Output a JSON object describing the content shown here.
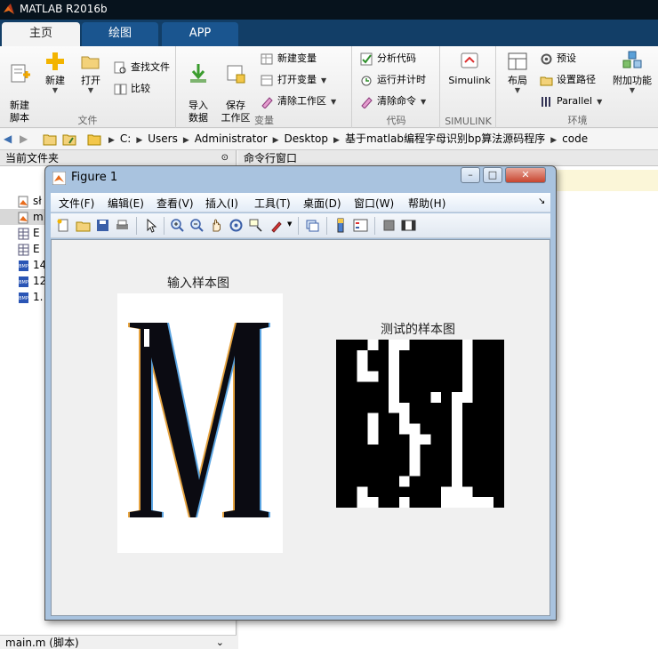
{
  "window": {
    "title": "MATLAB R2016b"
  },
  "tabs": [
    {
      "label": "主页",
      "active": true
    },
    {
      "label": "绘图",
      "active": false
    },
    {
      "label": "APP",
      "active": false
    }
  ],
  "ribbon": {
    "file": {
      "label": "文件",
      "new_script": "新建\n脚本",
      "new": "新建",
      "open": "打开",
      "find_files": "查找文件",
      "compare": "比较"
    },
    "variable": {
      "label": "变量",
      "import_data": "导入\n数据",
      "save_workspace": "保存\n工作区",
      "new_variable": "新建变量",
      "open_variable": "打开变量",
      "clear_workspace": "清除工作区"
    },
    "code": {
      "label": "代码",
      "analyze_code": "分析代码",
      "run_and_time": "运行并计时",
      "clear_commands": "清除命令"
    },
    "simulink": {
      "label": "SIMULINK",
      "button": "Simulink"
    },
    "environment": {
      "label": "环境",
      "layout": "布局",
      "preferences": "预设",
      "set_path": "设置路径",
      "parallel": "Parallel",
      "addons": "附加功能"
    }
  },
  "address": {
    "crumbs": [
      "C:",
      "Users",
      "Administrator",
      "Desktop",
      "基于matlab编程字母识别bp算法源码程序",
      "code"
    ]
  },
  "left_panel": {
    "title": "当前文件夹",
    "files": [
      "sł",
      "m",
      "E",
      "E",
      "14",
      "12",
      "1."
    ],
    "status": "main.m  (脚本)"
  },
  "right_panel": {
    "title": "命令行窗口"
  },
  "figure": {
    "title": "Figure 1",
    "menu": [
      "文件(F)",
      "编辑(E)",
      "查看(V)",
      "插入(I)",
      "工具(T)",
      "桌面(D)",
      "窗口(W)",
      "帮助(H)"
    ],
    "toolbar_icons": [
      "new-figure-icon",
      "open-file-icon",
      "save-icon",
      "print-icon",
      "pointer-icon",
      "zoom-in-icon",
      "zoom-out-icon",
      "pan-icon",
      "rotate-icon",
      "data-cursor-icon",
      "brush-icon",
      "link-icon",
      "colorbar-icon",
      "legend-icon",
      "hide-plot-tools-icon",
      "show-plot-tools-icon"
    ],
    "axes": [
      {
        "title": "输入样本图",
        "content": "M"
      },
      {
        "title": "测试的样本图"
      }
    ]
  },
  "colors": {
    "tab_active_bg": "#f3f3f3",
    "tab_strip": "#123e67",
    "titlebar": "#07131d",
    "figure_frame": "#a9c3df"
  }
}
